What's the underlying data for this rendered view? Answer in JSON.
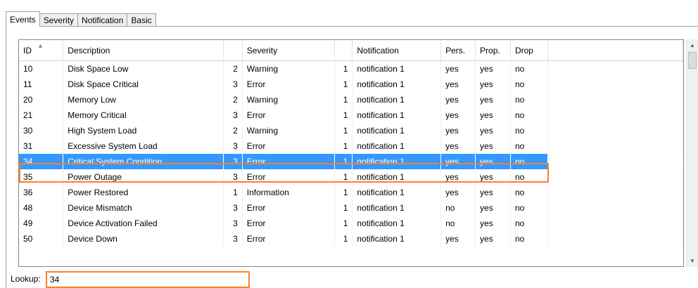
{
  "tabs": [
    {
      "label": "Events",
      "active": true
    },
    {
      "label": "Severity"
    },
    {
      "label": "Notification"
    },
    {
      "label": "Basic"
    }
  ],
  "table": {
    "columns": [
      "ID",
      "Description",
      "",
      "Severity",
      "",
      "Notification",
      "Pers.",
      "Prop.",
      "Drop"
    ],
    "sorted_column": "ID",
    "sort_direction": "ascending",
    "selected_row_id": "34",
    "rows": [
      {
        "id": "10",
        "description": "Disk Space Low",
        "sev_num": "2",
        "severity": "Warning",
        "notif_num": "1",
        "notification": "notification 1",
        "pers": "yes",
        "prop": "yes",
        "drop": "no"
      },
      {
        "id": "11",
        "description": "Disk Space Critical",
        "sev_num": "3",
        "severity": "Error",
        "notif_num": "1",
        "notification": "notification 1",
        "pers": "yes",
        "prop": "yes",
        "drop": "no"
      },
      {
        "id": "20",
        "description": "Memory Low",
        "sev_num": "2",
        "severity": "Warning",
        "notif_num": "1",
        "notification": "notification 1",
        "pers": "yes",
        "prop": "yes",
        "drop": "no"
      },
      {
        "id": "21",
        "description": "Memory Critical",
        "sev_num": "3",
        "severity": "Error",
        "notif_num": "1",
        "notification": "notification 1",
        "pers": "yes",
        "prop": "yes",
        "drop": "no"
      },
      {
        "id": "30",
        "description": "High System Load",
        "sev_num": "2",
        "severity": "Warning",
        "notif_num": "1",
        "notification": "notification 1",
        "pers": "yes",
        "prop": "yes",
        "drop": "no"
      },
      {
        "id": "31",
        "description": "Excessive System Load",
        "sev_num": "3",
        "severity": "Error",
        "notif_num": "1",
        "notification": "notification 1",
        "pers": "yes",
        "prop": "yes",
        "drop": "no"
      },
      {
        "id": "34",
        "description": "Critical System Condition",
        "sev_num": "3",
        "severity": "Error",
        "notif_num": "1",
        "notification": "notification 1",
        "pers": "yes",
        "prop": "yes",
        "drop": "no"
      },
      {
        "id": "35",
        "description": "Power Outage",
        "sev_num": "3",
        "severity": "Error",
        "notif_num": "1",
        "notification": "notification 1",
        "pers": "yes",
        "prop": "yes",
        "drop": "no"
      },
      {
        "id": "36",
        "description": "Power Restored",
        "sev_num": "1",
        "severity": "Information",
        "notif_num": "1",
        "notification": "notification 1",
        "pers": "yes",
        "prop": "yes",
        "drop": "no"
      },
      {
        "id": "48",
        "description": "Device Mismatch",
        "sev_num": "3",
        "severity": "Error",
        "notif_num": "1",
        "notification": "notification 1",
        "pers": "no",
        "prop": "yes",
        "drop": "no"
      },
      {
        "id": "49",
        "description": "Device Activation Failed",
        "sev_num": "3",
        "severity": "Error",
        "notif_num": "1",
        "notification": "notification 1",
        "pers": "no",
        "prop": "yes",
        "drop": "no"
      },
      {
        "id": "50",
        "description": "Device Down",
        "sev_num": "3",
        "severity": "Error",
        "notif_num": "1",
        "notification": "notification 1",
        "pers": "yes",
        "prop": "yes",
        "drop": "no"
      }
    ]
  },
  "lookup": {
    "label": "Lookup:",
    "value": "34"
  },
  "colors": {
    "selection": "#3399ff",
    "highlight_border": "#ff7f27"
  },
  "icons": {
    "sort": "sort-ascending-icon",
    "scroll_up": "scroll-up-icon",
    "scroll_down": "scroll-down-icon"
  }
}
